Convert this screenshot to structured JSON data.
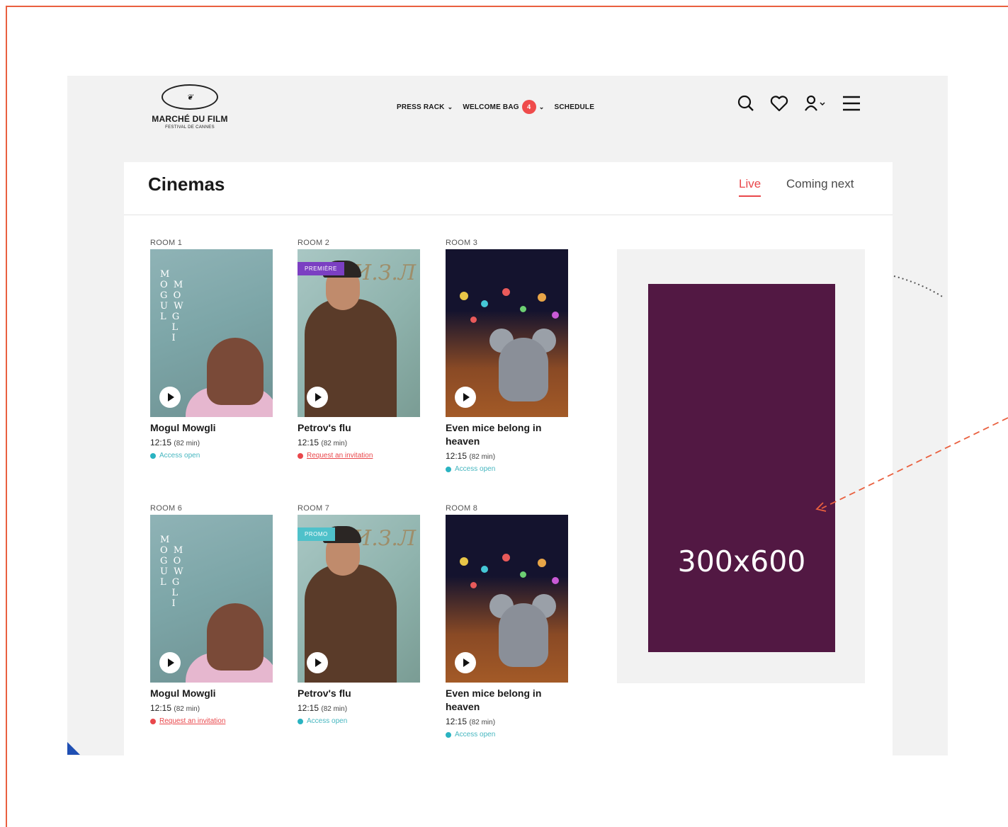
{
  "header": {
    "logo_text": "MARCHÉ DU FILM",
    "logo_subtext": "FESTIVAL DE CANNES",
    "nav": [
      {
        "label": "PRESS RACK"
      },
      {
        "label": "WELCOME BAG",
        "badge": "4"
      },
      {
        "label": "SCHEDULE"
      }
    ],
    "icons": [
      "search-icon",
      "heart-icon",
      "user-icon",
      "menu-icon"
    ]
  },
  "page": {
    "title": "Cinemas",
    "tabs": {
      "live": "Live",
      "coming_next": "Coming next"
    }
  },
  "rooms": [
    {
      "room": "ROOM 1",
      "film": "Mogul Mowgli",
      "time": "12:15",
      "duration": "(82 min)",
      "status": "Access open",
      "poster_letters": "M\nO  M\nG  O\nU  W\nL  G\n    L\n    I"
    },
    {
      "room": "ROOM 2",
      "film": "Petrov's flu",
      "time": "12:15",
      "duration": "(82 min)",
      "status": "Request an invitation",
      "tag": "PREMIÈRE"
    },
    {
      "room": "ROOM 3",
      "film": "Even mice belong in heaven",
      "time": "12:15",
      "duration": "(82 min)",
      "status": "Access open"
    },
    {
      "room": "ROOM 6",
      "film": "Mogul Mowgli",
      "time": "12:15",
      "duration": "(82 min)",
      "status": "Request an invitation",
      "poster_letters": "M\nO  M\nG  O\nU  W\nL  G\n    L\n    I"
    },
    {
      "room": "ROOM 7",
      "film": "Petrov's flu",
      "time": "12:15",
      "duration": "(82 min)",
      "status": "Access open",
      "tag": "PROMO"
    },
    {
      "room": "ROOM 8",
      "film": "Even mice belong in heaven",
      "time": "12:15",
      "duration": "(82 min)",
      "status": "Access open"
    }
  ],
  "ad": {
    "label": "300x600"
  },
  "colors": {
    "accent": "#e9474b",
    "ad_bg": "#521843",
    "teal": "#2ab3c1",
    "frame": "#e9603f"
  }
}
